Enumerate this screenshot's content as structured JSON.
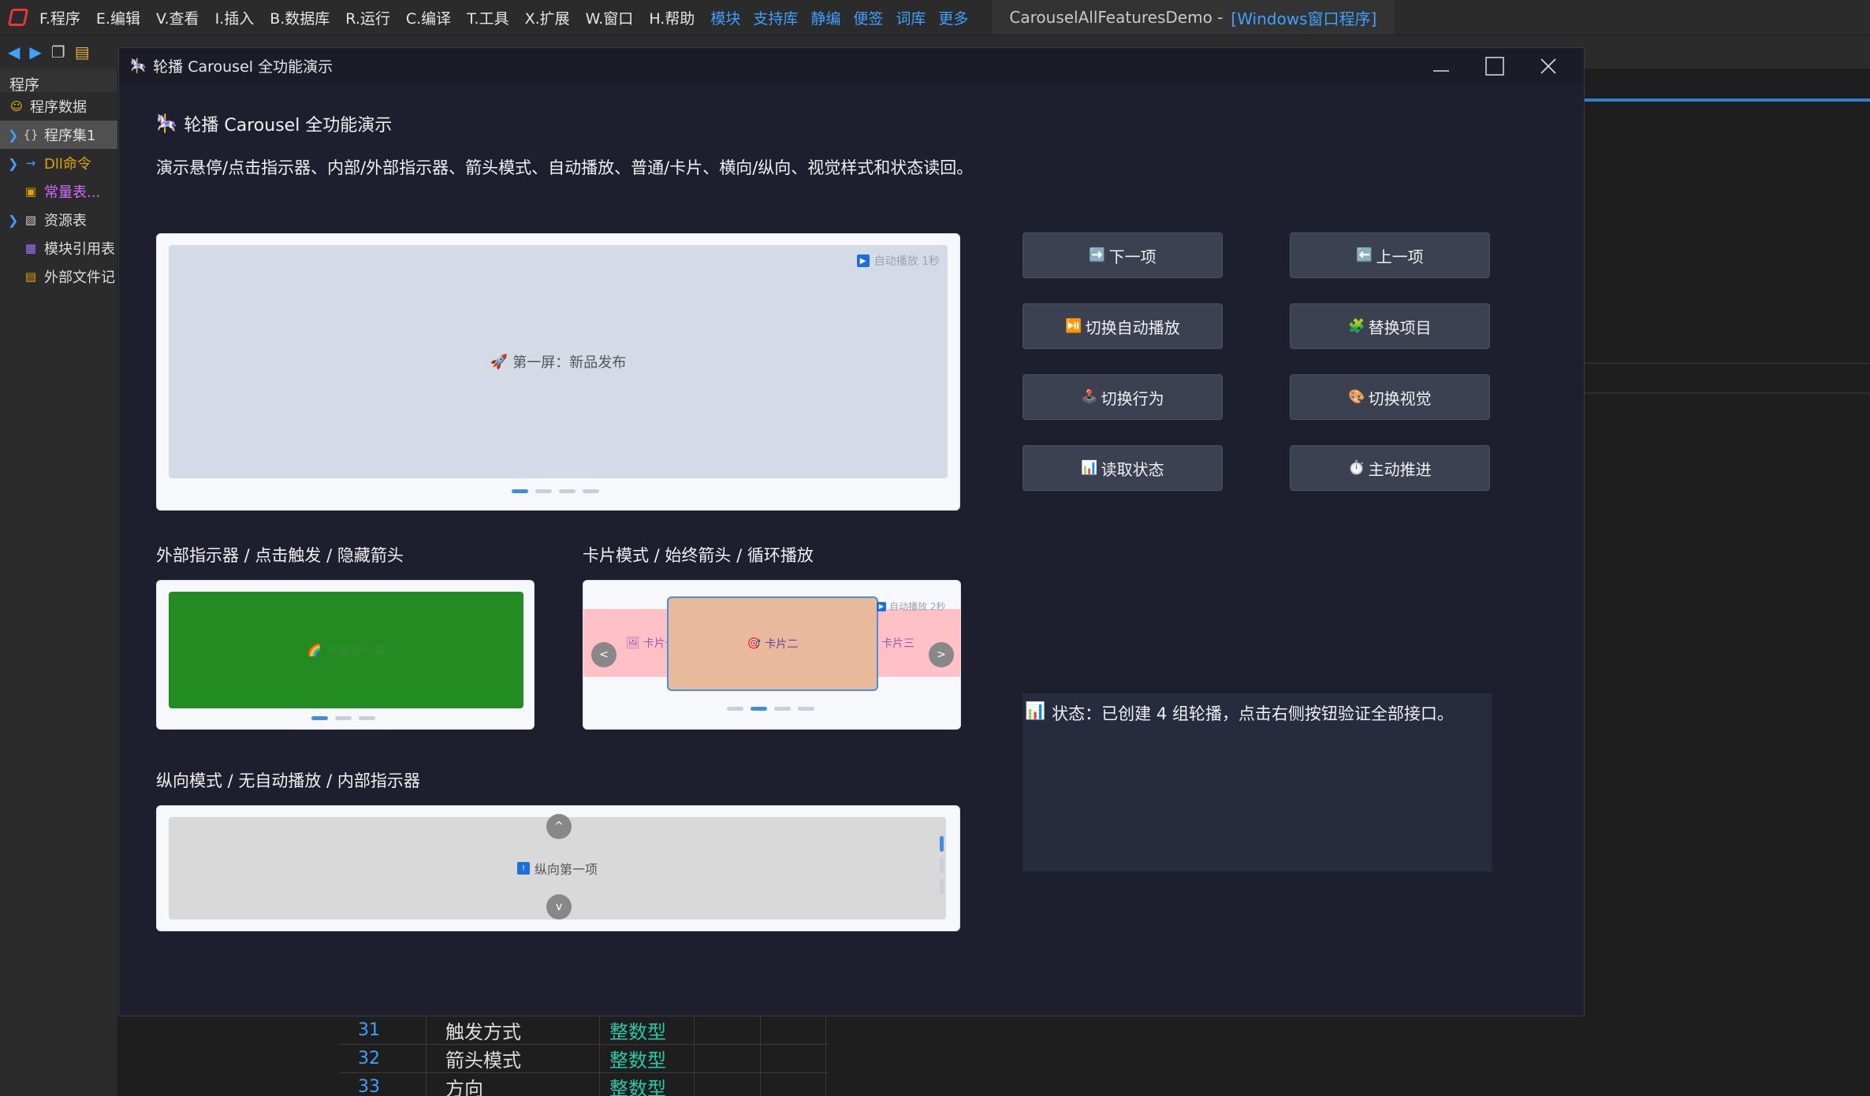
{
  "ide": {
    "menu": [
      "F.程序",
      "E.编辑",
      "V.查看",
      "I.插入",
      "B.数据库",
      "R.运行",
      "C.编译",
      "T.工具",
      "X.扩展",
      "W.窗口",
      "H.帮助"
    ],
    "menu_links": [
      "模块",
      "支持库",
      "静编",
      "便签",
      "词库",
      "更多"
    ],
    "title_main": "CarouselAllFeaturesDemo -",
    "title_accent": "[Windows窗口程序]",
    "sidebar_header": "程序",
    "tree": [
      {
        "label": "程序数据"
      },
      {
        "label": "程序集1"
      },
      {
        "label": "Dll命令"
      },
      {
        "label": "常量表..."
      },
      {
        "label": "资源表"
      },
      {
        "label": "模块引用表"
      },
      {
        "label": "外部文件记"
      }
    ],
    "table_rows": [
      {
        "num": "31",
        "name": "触发方式",
        "type": "整数型"
      },
      {
        "num": "32",
        "name": "箭头模式",
        "type": "整数型"
      },
      {
        "num": "33",
        "name": "方向",
        "type": "整数型"
      }
    ]
  },
  "window": {
    "title": "轮播 Carousel 全功能演示",
    "heading": "轮播 Carousel 全功能演示",
    "description": "演示悬停/点击指示器、内部/外部指示器、箭头模式、自动播放、普通/卡片、横向/纵向、视觉样式和状态读回。",
    "main_carousel": {
      "slide_text": "第一屏：新品发布",
      "auto_badge": "自动播放 1秒",
      "dot_count": 4,
      "active_dot": 0
    },
    "ext_label": "外部指示器 / 点击触发 / 隐藏箭头",
    "ext_carousel": {
      "slide_text": "外部第一屏",
      "dot_count": 3,
      "active_dot": 0
    },
    "card_label": "卡片模式 / 始终箭头 / 循环播放",
    "card_carousel": {
      "left_card": "卡片一",
      "center_card": "卡片二",
      "right_card": "卡片三",
      "auto_badge": "自动播放 2秒",
      "prev_arrow": "<",
      "next_arrow": ">",
      "dot_count": 4,
      "active_dot": 1
    },
    "vert_label": "纵向模式 / 无自动播放 / 内部指示器",
    "vert_carousel": {
      "slide_text": "纵向第一项",
      "up_arrow": "^",
      "down_arrow": "v",
      "dot_count": 3,
      "active_dot": 0
    },
    "buttons": {
      "next": "下一项",
      "prev": "上一项",
      "toggle_autoplay": "切换自动播放",
      "replace_items": "替换项目",
      "toggle_behavior": "切换行为",
      "toggle_visual": "切换视觉",
      "read_status": "读取状态",
      "manual_advance": "主动推进"
    },
    "status_text": "状态：已创建 4 组轮播，点击右侧按钮验证全部接口。"
  },
  "colors": {
    "window_bg": "#1e1f2e",
    "button_bg": "#3c4152",
    "status_bg": "#262c3d",
    "ext_slide": "#228b22",
    "card_band": "#ffc0c6",
    "card_center": "#e9b99b",
    "accent_blue": "#3f8fdc"
  }
}
